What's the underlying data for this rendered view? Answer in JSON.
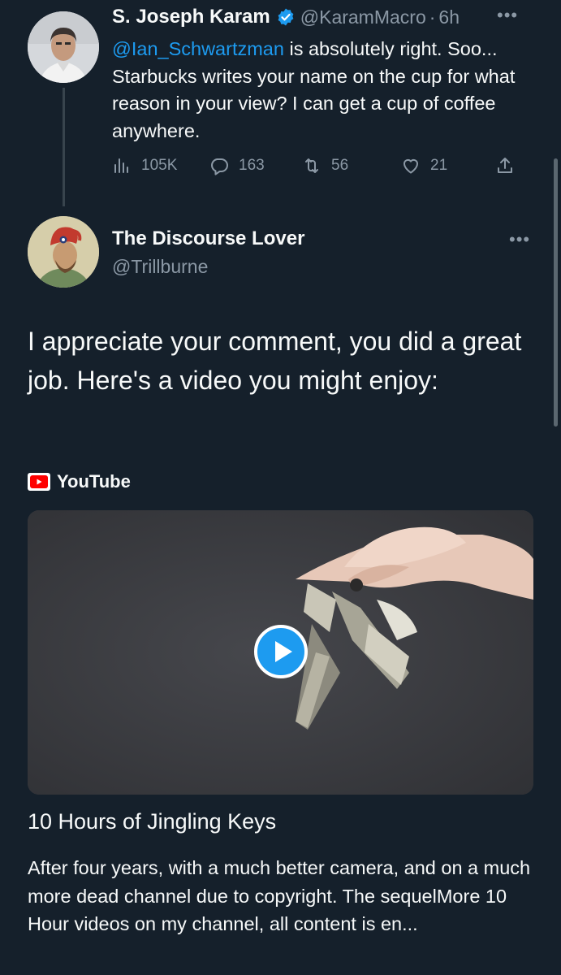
{
  "tweet1": {
    "name": "S. Joseph Karam",
    "handle": "@KaramMacro",
    "separator": "·",
    "time": "6h",
    "mention": "@Ian_Schwartzman",
    "text_after_mention": " is absolutely right. Soo... Starbucks writes your name on the cup for what reason in your view?  I can get a cup of coffee anywhere.",
    "actions": {
      "views": "105K",
      "replies": "163",
      "retweets": "56",
      "likes": "21"
    },
    "more_icon": "more-icon"
  },
  "tweet2": {
    "name": "The Discourse Lover",
    "handle": "@Trillburne",
    "text": "I appreciate your comment, you did a great job. Here's a video you might enjoy:",
    "card": {
      "source": "YouTube",
      "title": "10 Hours of Jingling Keys",
      "description": "After four years, with a much better camera, and on a much more dead channel due to copyright. The sequelMore 10 Hour videos on my channel, all content is en..."
    }
  },
  "colors": {
    "background": "#15202b",
    "accent": "#1d9bf0",
    "secondary_text": "#8b98a5",
    "youtube_red": "#ff0000"
  }
}
